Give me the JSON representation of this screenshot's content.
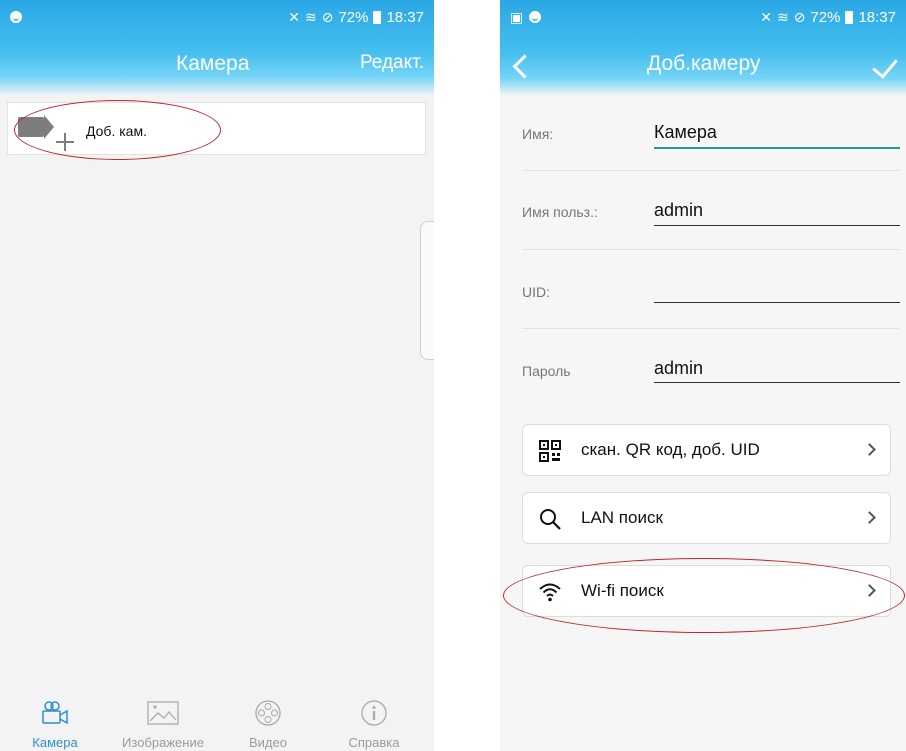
{
  "left": {
    "status": {
      "battery": "72%",
      "time": "18:37"
    },
    "header": {
      "title": "Камера",
      "edit": "Редакт."
    },
    "add_camera_label": "Доб. кам.",
    "tabs": [
      {
        "label": "Камера",
        "active": true
      },
      {
        "label": "Изображение",
        "active": false
      },
      {
        "label": "Видео",
        "active": false
      },
      {
        "label": "Справка",
        "active": false
      }
    ]
  },
  "right": {
    "status": {
      "battery": "72%",
      "time": "18:37"
    },
    "header": {
      "title": "Доб.камеру"
    },
    "fields": [
      {
        "label": "Имя:",
        "value": "Камера"
      },
      {
        "label": "Имя польз.:",
        "value": "admin"
      },
      {
        "label": "UID:",
        "value": ""
      },
      {
        "label": "Пароль",
        "value": "admin"
      }
    ],
    "buttons": [
      {
        "label": "скан. QR код, доб. UID",
        "icon": "qr-code-icon"
      },
      {
        "label": "LAN поиск",
        "icon": "search-icon"
      },
      {
        "label": "Wi-fi поиск",
        "icon": "wifi-icon"
      }
    ]
  },
  "colors": {
    "accent": "#46bff0",
    "active_tab": "#2c8fcf",
    "annotation": "#c0282b",
    "field_focus": "#1f9e8a"
  }
}
